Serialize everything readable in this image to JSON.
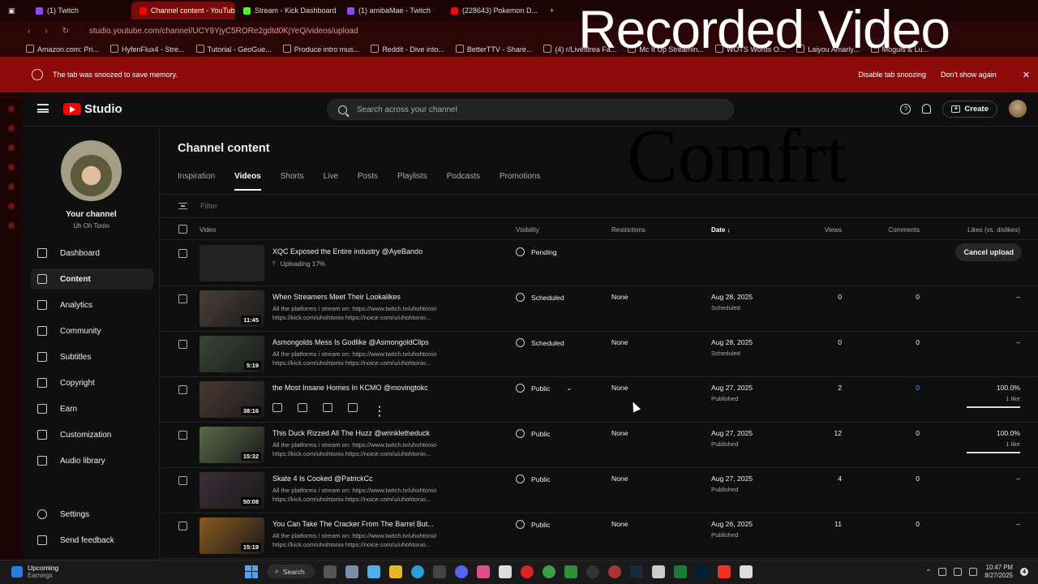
{
  "browser": {
    "tabs": [
      {
        "label": "(1) Twitch",
        "color": "#9146ff",
        "active": false
      },
      {
        "label": "Channel content - YouTube",
        "color": "#ff0000",
        "active": true
      },
      {
        "label": "Stream - Kick Dashboard",
        "color": "#53fc18",
        "active": false
      },
      {
        "label": "(1) amibaMae - Twitch",
        "color": "#9146ff",
        "active": false
      },
      {
        "label": "(228643) Pokemon D...",
        "color": "#ff0000",
        "active": false
      }
    ],
    "url": "studio.youtube.com/channel/UCY9YjyC5RORe2gdtd0KjYeQ/videos/upload",
    "bookmarks": [
      "Amazon.com: Pri...",
      "HyfenFlux4 - Stre...",
      "Tutorial - GeoGue...",
      "Produce intro mus...",
      "Reddit - Dive into...",
      "BetterTTV - Share...",
      "(4) r/Livestrea Fa...",
      "Mc It Up Streamin...",
      "WOTS Words O...",
      "Laiyou Amarly...",
      "Moguls & Lu..."
    ]
  },
  "snooze_bar": {
    "message": "The tab was snoozed to save memory.",
    "disable_label": "Disable tab snoozing",
    "dont_show_label": "Don't show again"
  },
  "topbar": {
    "logo_text": "Studio",
    "search_placeholder": "Search across your channel",
    "create_label": "Create"
  },
  "sidebar": {
    "your_channel": "Your channel",
    "channel_name": "Uh Oh Tonio",
    "items": [
      {
        "label": "Dashboard",
        "icon": "dashboard-icon",
        "active": false
      },
      {
        "label": "Content",
        "icon": "content-icon",
        "active": true
      },
      {
        "label": "Analytics",
        "icon": "analytics-icon",
        "active": false
      },
      {
        "label": "Community",
        "icon": "community-icon",
        "active": false
      },
      {
        "label": "Subtitles",
        "icon": "subtitles-icon",
        "active": false
      },
      {
        "label": "Copyright",
        "icon": "copyright-icon",
        "active": false
      },
      {
        "label": "Earn",
        "icon": "earn-icon",
        "active": false
      },
      {
        "label": "Customization",
        "icon": "customization-icon",
        "active": false
      },
      {
        "label": "Audio library",
        "icon": "audio-library-icon",
        "active": false
      }
    ],
    "settings": "Settings",
    "feedback": "Send feedback"
  },
  "main": {
    "title": "Channel content",
    "tabs": [
      "Inspiration",
      "Videos",
      "Shorts",
      "Live",
      "Posts",
      "Playlists",
      "Podcasts",
      "Promotions"
    ],
    "active_tab": "Videos",
    "filter_placeholder": "Filter",
    "columns": {
      "video": "Video",
      "visibility": "Visibility",
      "restrictions": "Restrictions",
      "date": "Date",
      "views": "Views",
      "comments": "Comments",
      "likes": "Likes (vs. dislikes)"
    }
  },
  "uploading": {
    "title": "XQC Exposed the Entire industry @AyeBando",
    "status": "Uploading 17%",
    "progress_percent": 17,
    "visibility": "Pending",
    "cancel_label": "Cancel upload"
  },
  "videos": [
    {
      "title": "When Streamers Meet Their Lookalikes",
      "desc1": "All the platforms i stream on: https://www.twitch.tv/uhohtonio",
      "desc2": "https://kick.com/uhohtonio https://noice.com/u/uhohtonio...",
      "duration": "11:45",
      "visibility": "Scheduled",
      "restrictions": "None",
      "date": "Aug 28, 2025",
      "date_sub": "Scheduled",
      "views": "0",
      "comments": "0",
      "likes": "–",
      "likes_sub": "",
      "thumb": "#4a3f38"
    },
    {
      "title": "Asmongolds Mess Is Godlike @AsmongoldClips",
      "desc1": "All the platforms i stream on: https://www.twitch.tv/uhohtonio",
      "desc2": "https://kick.com/uhohtonio https://noice.com/u/uhohtonio...",
      "duration": "5:19",
      "visibility": "Scheduled",
      "restrictions": "None",
      "date": "Aug 28, 2025",
      "date_sub": "Scheduled",
      "views": "0",
      "comments": "0",
      "likes": "–",
      "likes_sub": "",
      "thumb": "#3a4736"
    },
    {
      "title": "the Most Insane Homes In KCMO @movingtokc",
      "desc1": "",
      "desc2": "",
      "duration": "38:16",
      "visibility": "Public",
      "restrictions": "None",
      "date": "Aug 27, 2025",
      "date_sub": "Published",
      "views": "2",
      "comments": "0",
      "likes": "100.0%",
      "likes_sub": "1 like",
      "thumb": "#4b3a32"
    },
    {
      "title": "This Duck Rizzed All The Huzz @wrinkletheduck",
      "desc1": "All the platforms i stream on: https://www.twitch.tv/uhohtonio",
      "desc2": "https://kick.com/uhohtonio https://noice.com/u/uhohtonio...",
      "duration": "15:32",
      "visibility": "Public",
      "restrictions": "None",
      "date": "Aug 27, 2025",
      "date_sub": "Published",
      "views": "12",
      "comments": "0",
      "likes": "100.0%",
      "likes_sub": "1 like",
      "thumb": "#5a6a48"
    },
    {
      "title": "Skate 4 Is Cooked @PatrickCc",
      "desc1": "All the platforms i stream on: https://www.twitch.tv/uhohtonio",
      "desc2": "https://kick.com/uhohtonio https://noice.com/u/uhohtonio...",
      "duration": "50:08",
      "visibility": "Public",
      "restrictions": "None",
      "date": "Aug 27, 2025",
      "date_sub": "Published",
      "views": "4",
      "comments": "0",
      "likes": "–",
      "likes_sub": "",
      "thumb": "#3c2f3a"
    },
    {
      "title": "You Can Take The Cracker From The Barrel But...",
      "desc1": "All the platforms i stream on: https://www.twitch.tv/uhohtonio",
      "desc2": "https://kick.com/uhohtonio https://noice.com/u/uhohtonio...",
      "duration": "15:19",
      "visibility": "Public",
      "restrictions": "None",
      "date": "Aug 26, 2025",
      "date_sub": "Published",
      "views": "11",
      "comments": "0",
      "likes": "–",
      "likes_sub": "",
      "thumb": "#8a5a22"
    }
  ],
  "overlay": {
    "recorded": "Recorded Video",
    "comfrt": "Comfrt"
  },
  "taskbar": {
    "weather_title": "Upcoming",
    "weather_sub": "Earnings",
    "search_label": "Search",
    "time": "10:47 PM",
    "date": "8/27/2025",
    "notif_count": "4"
  },
  "colors": {
    "accent_red": "#ff0000",
    "comment_highlight": "#3ea6ff"
  }
}
